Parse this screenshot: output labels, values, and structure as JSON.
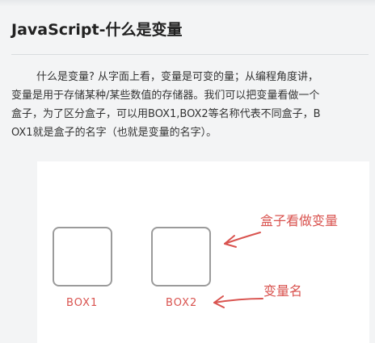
{
  "article": {
    "title": "JavaScript-什么是变量",
    "paragraph_lines": [
      "什么是变量? 从字面上看，变量是可变的量；从编程角度讲，",
      "变量是用于存储某种/某些数值的存储器。我们可以把变量看做一个",
      "盒子，为了区分盒子，可以用BOX1,BOX2等名称代表不同盒子，B",
      "OX1就是盒子的名字（也就是变量的名字）。"
    ]
  },
  "figure": {
    "box1_label": "BOX1",
    "box2_label": "BOX2",
    "annotation_box": "盒子看做变量",
    "annotation_name": "变量名",
    "accent_color": "#d9534f",
    "box_border_color": "#9b9b9b"
  }
}
